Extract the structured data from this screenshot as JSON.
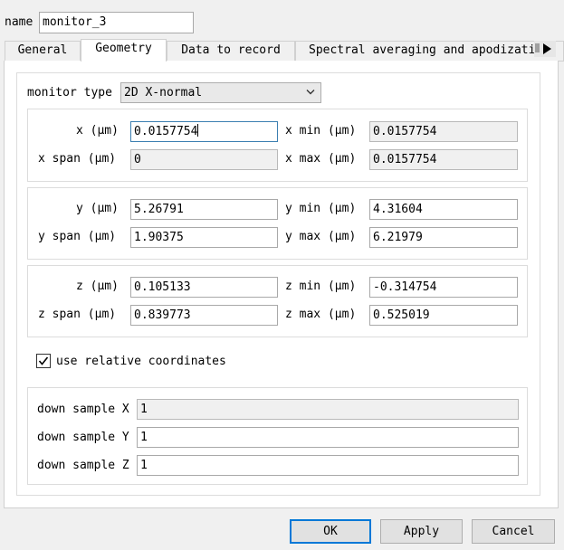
{
  "name": {
    "label": "name",
    "value": "monitor_3"
  },
  "tabs": [
    {
      "label": "General"
    },
    {
      "label": "Geometry"
    },
    {
      "label": "Data to record"
    },
    {
      "label": "Spectral averaging and apodization"
    }
  ],
  "monitor_type": {
    "label": "monitor type",
    "value": "2D X-normal"
  },
  "x_group": {
    "center_label": "x (μm)",
    "center_value": "0.0157754",
    "span_label": "x span (μm)",
    "span_value": "0",
    "min_label": "x min (μm)",
    "min_value": "0.0157754",
    "max_label": "x max (μm)",
    "max_value": "0.0157754"
  },
  "y_group": {
    "center_label": "y (μm)",
    "center_value": "5.26791",
    "span_label": "y span (μm)",
    "span_value": "1.90375",
    "min_label": "y min (μm)",
    "min_value": "4.31604",
    "max_label": "y max (μm)",
    "max_value": "6.21979"
  },
  "z_group": {
    "center_label": "z (μm)",
    "center_value": "0.105133",
    "span_label": "z span (μm)",
    "span_value": "0.839773",
    "min_label": "z min (μm)",
    "min_value": "-0.314754",
    "max_label": "z max (μm)",
    "max_value": "0.525019"
  },
  "relative": {
    "label": "use relative coordinates",
    "checked": true
  },
  "down_sample": {
    "x_label": "down sample X",
    "x_value": "1",
    "y_label": "down sample Y",
    "y_value": "1",
    "z_label": "down sample Z",
    "z_value": "1"
  },
  "buttons": {
    "ok": "OK",
    "apply": "Apply",
    "cancel": "Cancel"
  },
  "icons": {
    "dropdown": "chevron-down-icon",
    "check": "check-icon",
    "scroll": "arrow-right-icon"
  }
}
